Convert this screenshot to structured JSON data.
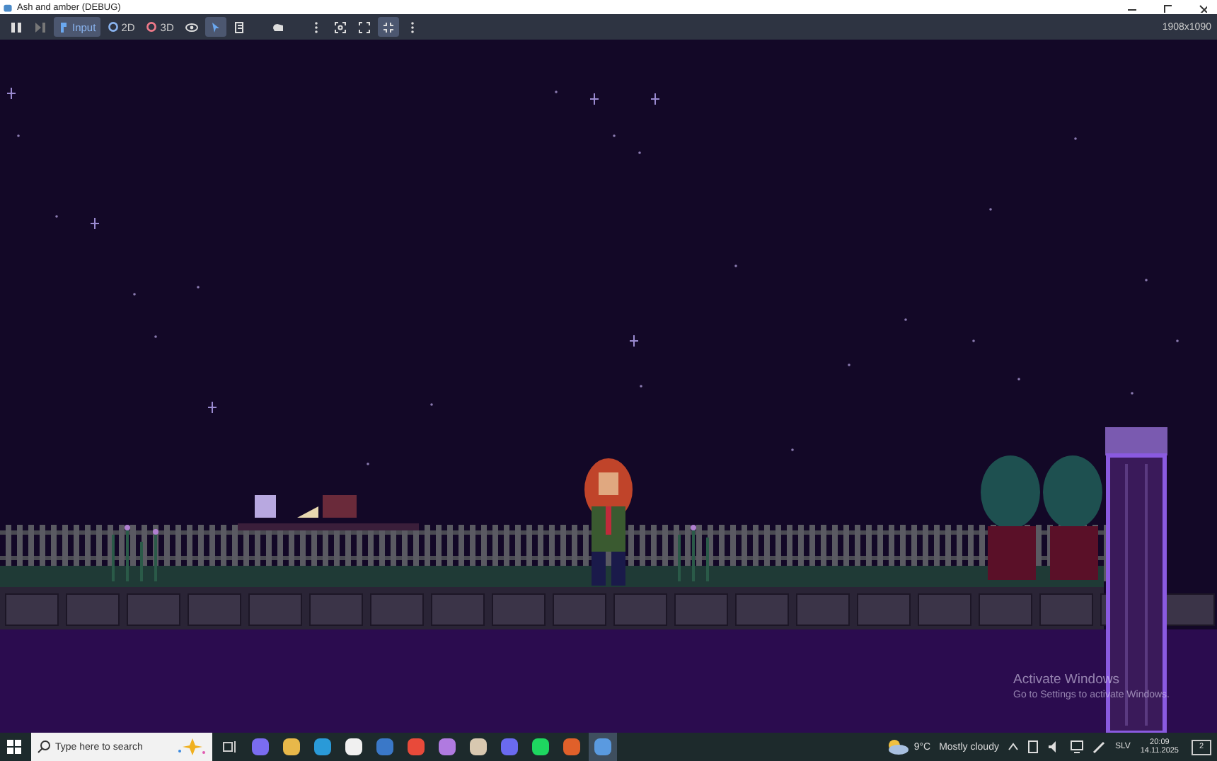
{
  "window": {
    "title": "Ash and amber (DEBUG)"
  },
  "toolbar": {
    "icon_buttons_left": [
      {
        "selected": false
      },
      {
        "selected": false
      }
    ],
    "modes": [
      {
        "label": "Input",
        "selected": true
      },
      {
        "label": "2D",
        "selected": false
      },
      {
        "label": "3D",
        "selected": false
      }
    ],
    "icon_buttons_right": [
      {
        "selected": false
      },
      {
        "selected": true
      },
      {
        "selected": false
      },
      {
        "selected": false
      },
      {
        "selected": false
      },
      {
        "selected": false
      },
      {
        "selected": false
      },
      {
        "selected": true
      },
      {
        "selected": false
      }
    ],
    "resolution": "1908x1090"
  },
  "watermark": {
    "title": "Activate Windows",
    "subtitle": "Go to Settings to activate Windows."
  },
  "taskbar": {
    "search": {
      "placeholder": "Type here to search"
    },
    "apps": [
      {
        "color": "#7a6cf0",
        "selected": false
      },
      {
        "color": "#e8b84a",
        "selected": false
      },
      {
        "color": "#2a9ad8",
        "selected": false
      },
      {
        "color": "#f0f0f0",
        "selected": false
      },
      {
        "color": "#3a78c8",
        "selected": false
      },
      {
        "color": "#e84a3a",
        "selected": false
      },
      {
        "color": "#b07ae0",
        "selected": false
      },
      {
        "color": "#d8c8b0",
        "selected": false
      },
      {
        "color": "#6a6af0",
        "selected": false
      },
      {
        "color": "#1ed760",
        "selected": false
      },
      {
        "color": "#e0602a",
        "selected": false
      },
      {
        "color": "#5a9ae0",
        "selected": true
      }
    ],
    "weather": {
      "temperature": "9°C",
      "condition": "Mostly cloudy"
    },
    "language": "SLV",
    "time": "20:09",
    "date": "14.11.2025",
    "notifications": "2"
  }
}
